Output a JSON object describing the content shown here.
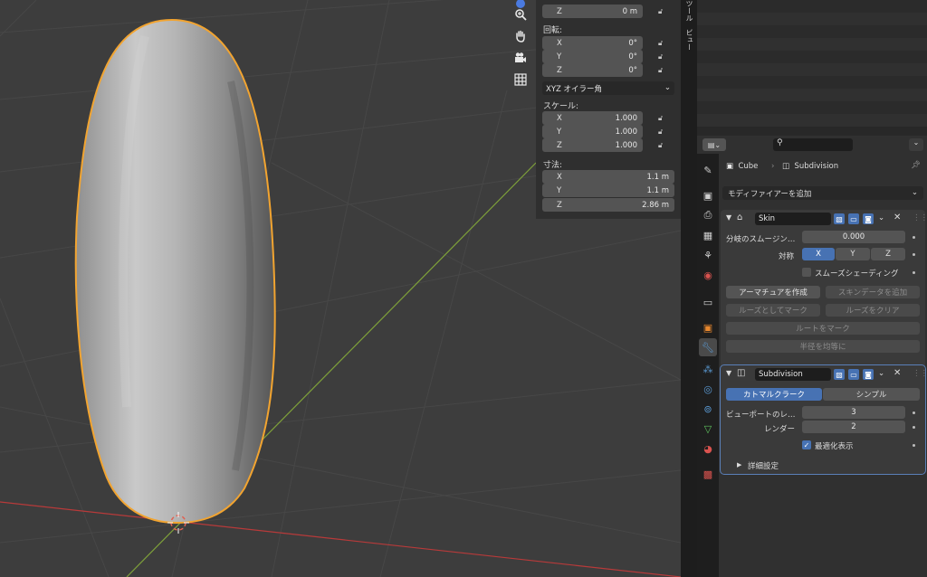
{
  "npanel": {
    "location_z_axis": "Z",
    "location_z_value": "0 m",
    "rotation_label": "回転:",
    "rotation": [
      {
        "axis": "X",
        "value": "0°"
      },
      {
        "axis": "Y",
        "value": "0°"
      },
      {
        "axis": "Z",
        "value": "0°"
      }
    ],
    "rotation_mode": "XYZ オイラー角",
    "scale_label": "スケール:",
    "scale": [
      {
        "axis": "X",
        "value": "1.000"
      },
      {
        "axis": "Y",
        "value": "1.000"
      },
      {
        "axis": "Z",
        "value": "1.000"
      }
    ],
    "dimensions_label": "寸法:",
    "dimensions": [
      {
        "axis": "X",
        "value": "1.1 m"
      },
      {
        "axis": "Y",
        "value": "1.1 m"
      },
      {
        "axis": "Z",
        "value": "2.86 m"
      }
    ]
  },
  "vtabs": {
    "tool": "ツール",
    "view": "ビュー"
  },
  "props": {
    "breadcrumb_object": "Cube",
    "breadcrumb_modifier": "Subdivision",
    "add_modifier": "モディファイアーを追加",
    "skin": {
      "name": "Skin",
      "branch_smoothing_label": "分岐のスムージン…",
      "branch_smoothing_value": "0.000",
      "symmetry_label": "対称",
      "sym_x": "X",
      "sym_y": "Y",
      "sym_z": "Z",
      "smooth_shading": "スムーズシェーディング",
      "create_armature": "アーマチュアを作成",
      "add_skin_data": "スキンデータを追加",
      "mark_loose": "ルーズとしてマーク",
      "clear_loose": "ルーズをクリア",
      "mark_root": "ルートをマーク",
      "equalize_radii": "半径を均等に"
    },
    "subdivision": {
      "name": "Subdivision",
      "catmull_clark": "カトマルクラーク",
      "simple": "シンプル",
      "viewport_label": "ビューポートのレ…",
      "viewport_value": "3",
      "render_label": "レンダー",
      "render_value": "2",
      "optimal_display": "最適化表示",
      "advanced": "詳細設定"
    }
  },
  "colors": {
    "accent": "#4772b3",
    "selection_outline": "#f2a430",
    "x_axis": "#b83a3a",
    "y_axis": "#7ea03a"
  }
}
